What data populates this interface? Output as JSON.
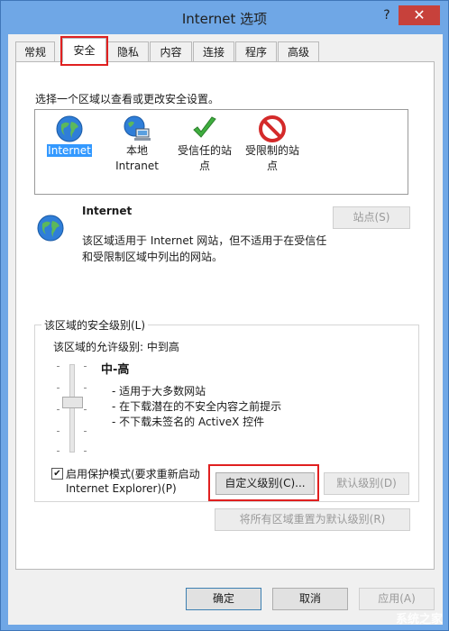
{
  "window": {
    "title": "Internet 选项",
    "help": "?",
    "close": "✕"
  },
  "tabs": [
    "常规",
    "安全",
    "隐私",
    "内容",
    "连接",
    "程序",
    "高级"
  ],
  "instruction": "选择一个区域以查看或更改安全设置。",
  "zones": [
    {
      "label": "Internet",
      "icon": "globe-icon"
    },
    {
      "label": "本地\nIntranet",
      "icon": "intranet-icon"
    },
    {
      "label": "受信任的站\n点",
      "icon": "check-icon"
    },
    {
      "label": "受限制的站\n点",
      "icon": "restricted-icon"
    }
  ],
  "selected_zone": {
    "name": "Internet",
    "description_line1": "该区域适用于 Internet 网站，但不适用于在受信任",
    "description_line2": "和受限制区域中列出的网站。",
    "sites_button": "站点(S)"
  },
  "security_level": {
    "group_title": "该区域的安全级别(L)",
    "allowed_levels": "该区域的允许级别: 中到高",
    "level_name": "中-高",
    "bullets": [
      "- 适用于大多数网站",
      "- 在下载潜在的不安全内容之前提示",
      "- 不下载未签名的 ActiveX 控件"
    ],
    "slider_level": 0.62
  },
  "protected_mode": {
    "checked": true,
    "label_line1": "启用保护模式(要求重新启动",
    "label_line2": "Internet Explorer)(P)"
  },
  "buttons": {
    "custom_level": "自定义级别(C)...",
    "default_level": "默认级别(D)",
    "reset_all": "将所有区域重置为默认级别(R)",
    "ok": "确定",
    "cancel": "取消",
    "apply": "应用(A)"
  },
  "watermark": "系统之家",
  "colors": {
    "highlight_border": "#e02020",
    "selection": "#3399ff",
    "title_bar": "#6fa7e6",
    "close_button": "#c7413b"
  }
}
